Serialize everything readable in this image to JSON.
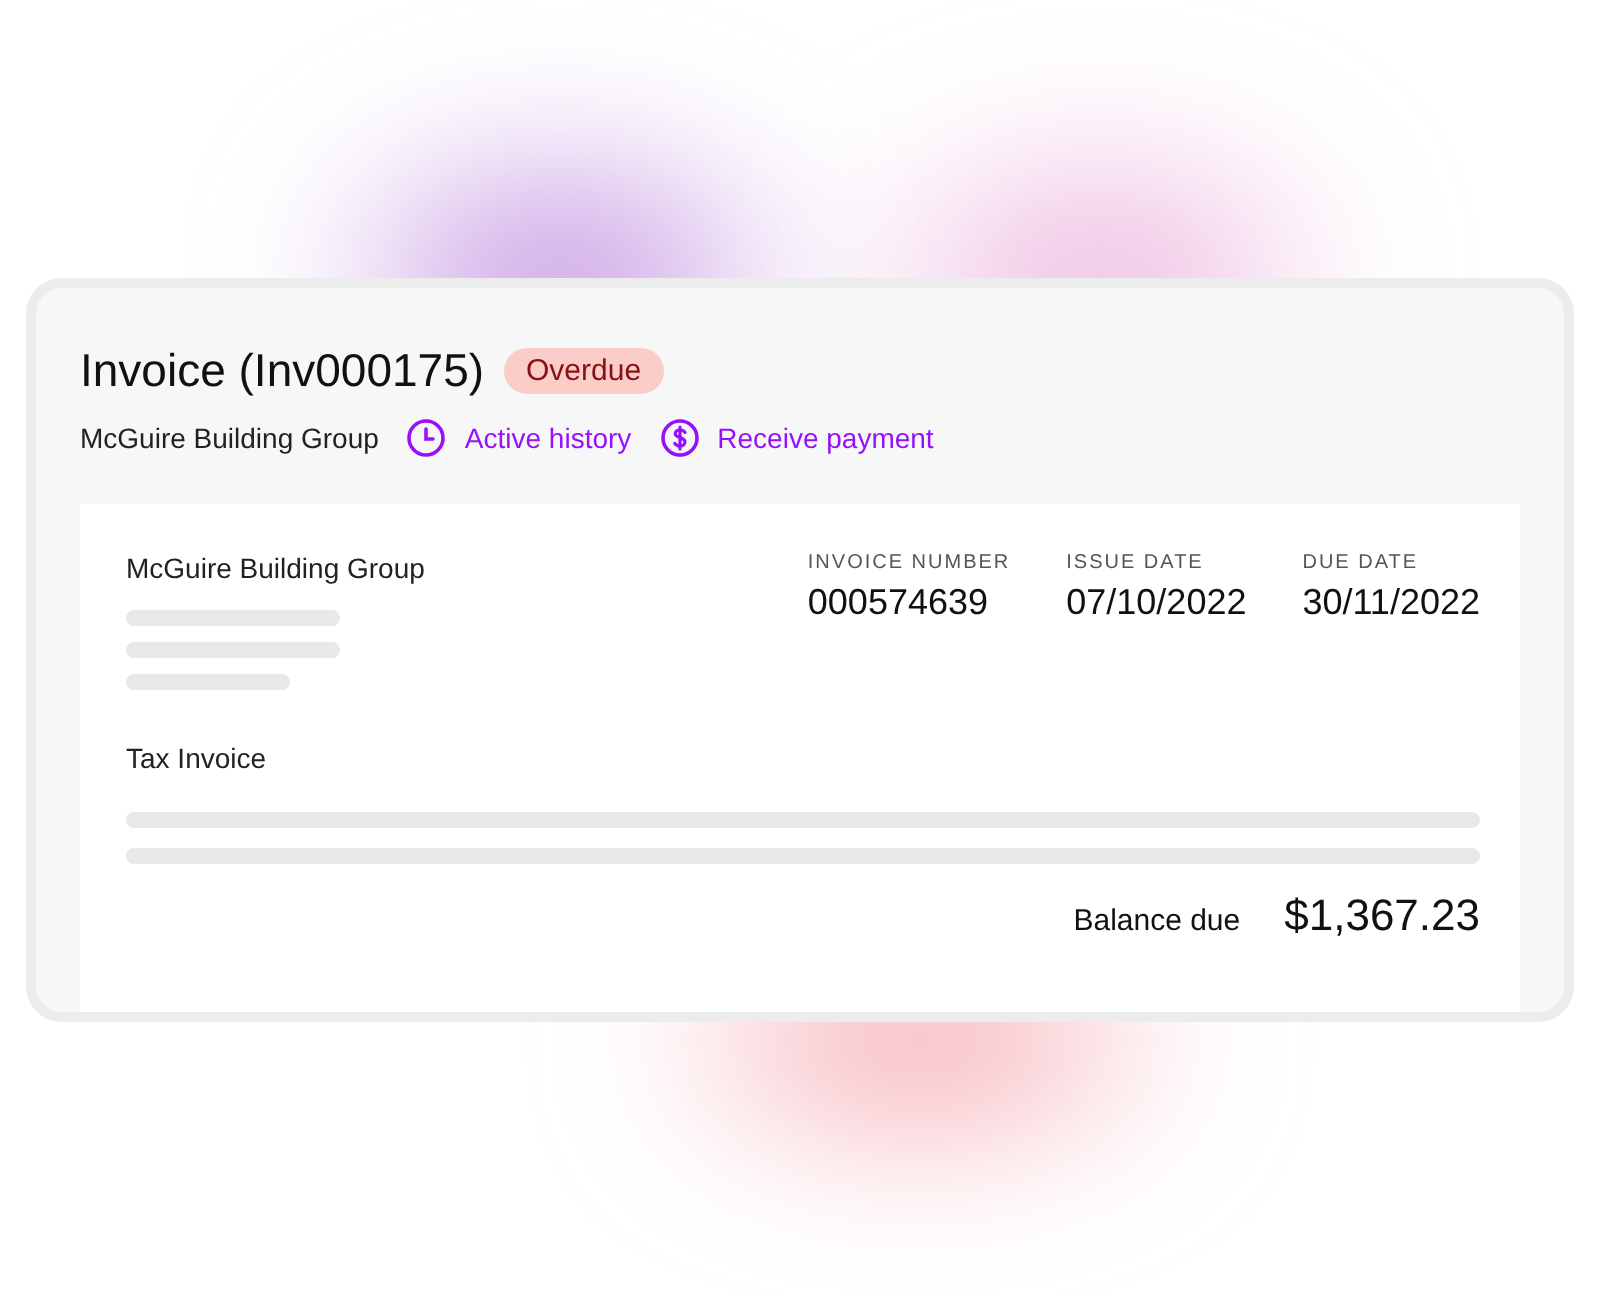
{
  "header": {
    "title": "Invoice (Inv000175)",
    "status": {
      "label": "Overdue",
      "kind": "overdue"
    },
    "customer": "McGuire Building Group",
    "actions": [
      {
        "label": "Active history",
        "kind": "history"
      },
      {
        "label": "Receive payment",
        "kind": "payment"
      }
    ]
  },
  "document": {
    "customer": "McGuire Building Group",
    "fields": [
      {
        "label": "INVOICE NUMBER",
        "value": "000574639"
      },
      {
        "label": "ISSUE DATE",
        "value": "07/10/2022"
      },
      {
        "label": "DUE DATE",
        "value": "30/11/2022"
      }
    ],
    "doc_type": "Tax Invoice",
    "balance_label": "Balance due",
    "balance": "$1,367.23"
  }
}
